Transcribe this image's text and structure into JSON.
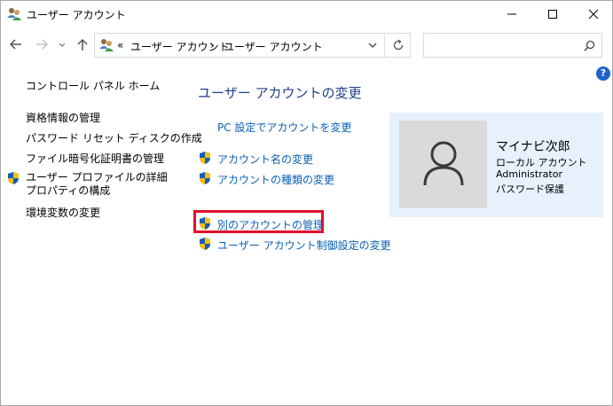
{
  "window": {
    "title": "ユーザー アカウント"
  },
  "address_bar": {
    "overflow": "«",
    "crumbs": [
      "ユーザー アカウント",
      "ユーザー アカウント"
    ],
    "separator": "›"
  },
  "search": {
    "placeholder": ""
  },
  "help": {
    "label": "?"
  },
  "sidebar": {
    "home_link": "コントロール パネル ホーム",
    "links": [
      {
        "label": "資格情報の管理"
      },
      {
        "label": "パスワード リセット ディスクの作成"
      },
      {
        "label": "ファイル暗号化証明書の管理"
      },
      {
        "label": "ユーザー プロファイルの詳細プロパティの構成"
      },
      {
        "label": "環境変数の変更"
      }
    ]
  },
  "main": {
    "heading": "ユーザー アカウントの変更",
    "links": [
      {
        "label": "PC 設定でアカウントを変更"
      },
      {
        "label": "アカウント名の変更"
      },
      {
        "label": "アカウントの種類の変更"
      },
      {
        "label": "別のアカウントの管理"
      },
      {
        "label": "ユーザー アカウント制御設定の変更"
      }
    ]
  },
  "user_card": {
    "name": "マイナビ次郎",
    "account_type": "ローカル アカウント",
    "role": "Administrator",
    "password_status": "パスワード保護"
  },
  "colors": {
    "link": "#0a5fb4",
    "heading": "#1f3f8a",
    "card_background": "#e6f1fb",
    "highlight": "#e0102b",
    "shield_blue": "#1b5bb8",
    "shield_yellow": "#f4c20d"
  },
  "icons": {
    "title": "users-icon",
    "back": "arrow-left-icon",
    "forward": "arrow-right-icon",
    "recent": "chevron-down-icon",
    "up": "arrow-up-icon",
    "refresh": "refresh-icon",
    "search": "search-icon",
    "uac": "shield-icon",
    "avatar": "person-icon"
  }
}
